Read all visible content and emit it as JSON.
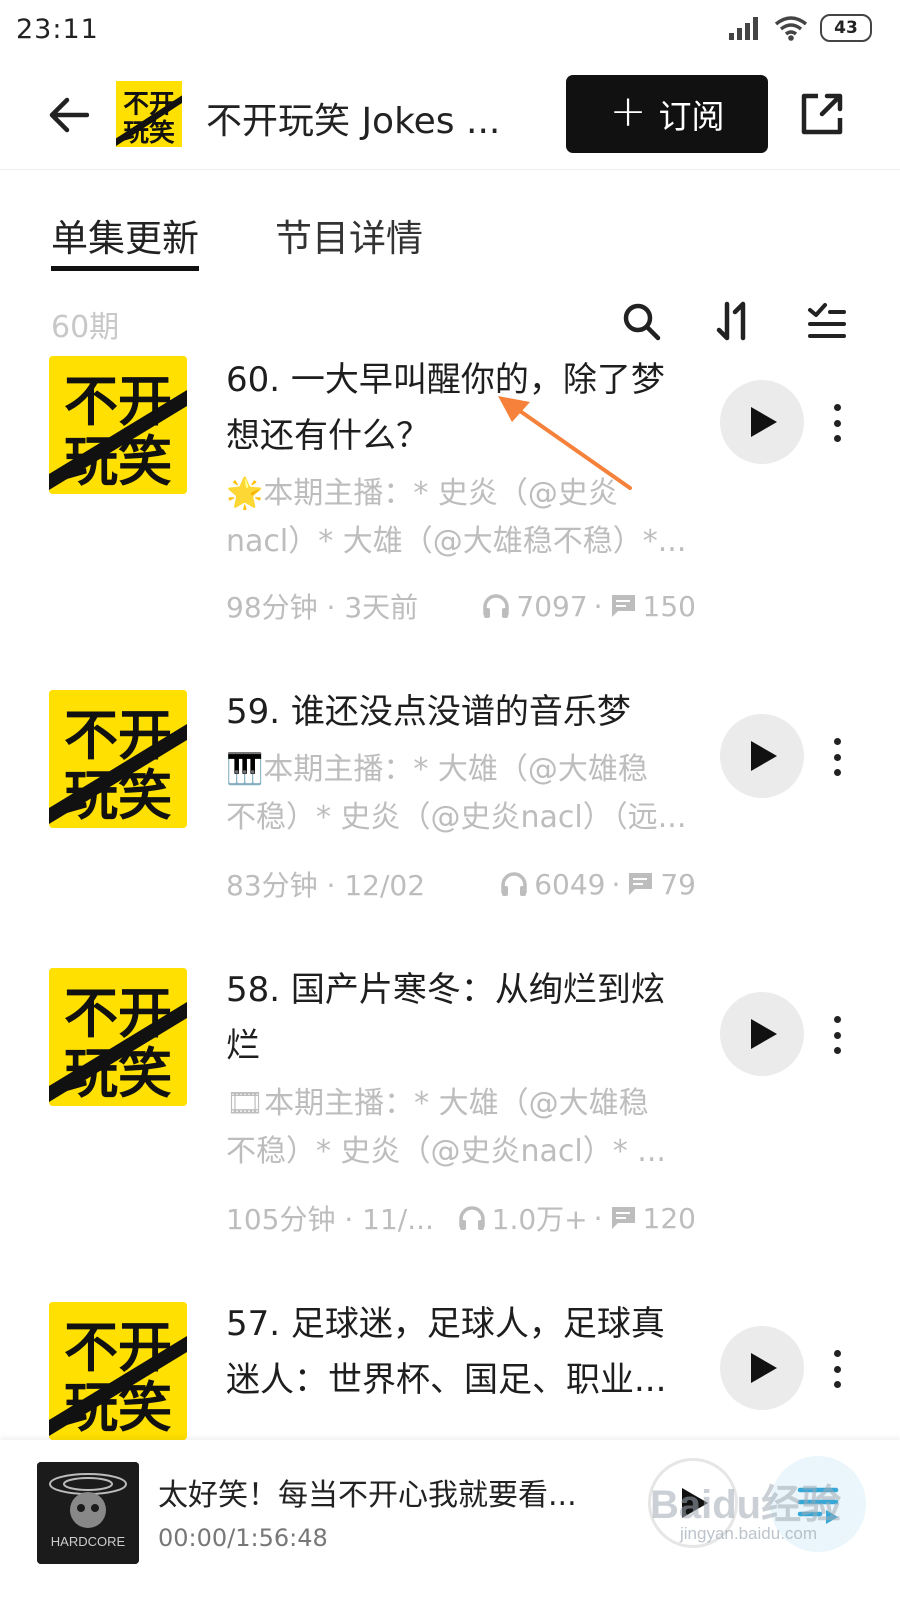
{
  "status_bar": {
    "time": "23:11",
    "battery": "43"
  },
  "header": {
    "podcast_logo_text": "不开玩笑",
    "podcast_title": "不开玩笑 Jokes ...",
    "subscribe_label": "订阅",
    "subscribe_icon": "plus-icon",
    "share_icon": "share-icon"
  },
  "tabs": [
    {
      "label": "单集更新",
      "active": true
    },
    {
      "label": "节目详情",
      "active": false
    }
  ],
  "list_toolbar": {
    "episode_count": "60期",
    "icons": [
      "search-icon",
      "sort-icon",
      "filter-icon"
    ]
  },
  "episodes": [
    {
      "title": "60. 一大早叫醒你的，除了梦想还有什么？",
      "desc_line1": "🌟本期主播：* 史炎（@史炎",
      "desc_line2": "nacl）* 大雄（@大雄稳不稳）*...",
      "duration_date": "98分钟 · 3天前",
      "plays": "7097",
      "comments": "150"
    },
    {
      "title": "59. 谁还没点没谱的音乐梦",
      "desc_line1": "🎹本期主播：* 大雄（@大雄稳",
      "desc_line2": "不稳）* 史炎（@史炎nacl）（远...",
      "duration_date": "83分钟 · 12/02",
      "plays": "6049",
      "comments": "79"
    },
    {
      "title": "58. 国产片寒冬：从绚烂到炫烂",
      "desc_line1": "🎞本期主播：* 大雄（@大雄稳",
      "desc_line2": "不稳）* 史炎（@史炎nacl）* ...",
      "duration_date": "105分钟 · 11/...",
      "plays": "1.0万+",
      "comments": "120"
    },
    {
      "title": "57. 足球迷，足球人，足球真迷人：世界杯、国足、职业...",
      "desc_line1": "",
      "desc_line2": "",
      "duration_date": "",
      "plays": "",
      "comments": ""
    }
  ],
  "mini_player": {
    "title": "太好笑！每当不开心我就要看...",
    "time": "00:00/1:56:48",
    "cover_text": "HARDCORE"
  },
  "watermark": {
    "text": "Baidu经验",
    "sub": "jingyan.baidu.com"
  },
  "colors": {
    "accent_yellow": "#ffe000",
    "annotation_orange": "#f5813a",
    "muted_gray": "#bdbdbd"
  }
}
